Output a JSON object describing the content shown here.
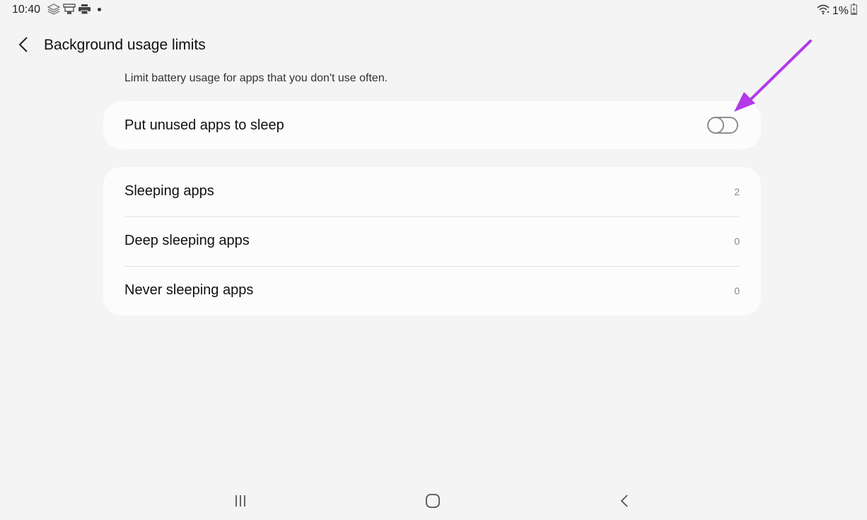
{
  "status_bar": {
    "time": "10:40",
    "left_icons": [
      "layers-icon",
      "screen-record-icon",
      "printer-icon",
      "notification-dot"
    ],
    "wifi_icon": "wifi-icon",
    "battery_percent": "1%",
    "battery_icon": "battery-charging-icon"
  },
  "header": {
    "back_icon": "chevron-left-icon",
    "title": "Background usage limits"
  },
  "description": "Limit battery usage for apps that you don't use often.",
  "toggle_card": {
    "label": "Put unused apps to sleep",
    "enabled": false
  },
  "list_card": {
    "items": [
      {
        "label": "Sleeping apps",
        "count": "2"
      },
      {
        "label": "Deep sleeping apps",
        "count": "0"
      },
      {
        "label": "Never sleeping apps",
        "count": "0"
      }
    ]
  },
  "annotation": {
    "arrow_color": "#b23ae8"
  },
  "nav_bar": {
    "recents_icon": "recents-icon",
    "home_icon": "home-icon",
    "back_icon": "back-icon"
  },
  "colors": {
    "background": "#f4f4f4",
    "card": "#fcfcfc",
    "toggle_off": "#8e8e8e"
  }
}
